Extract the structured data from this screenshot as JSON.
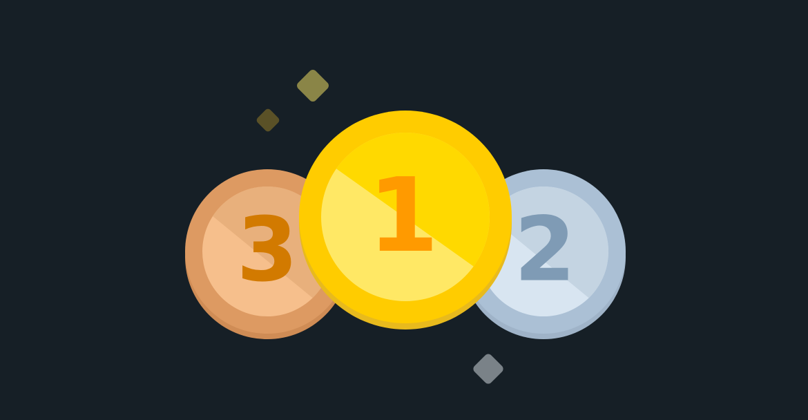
{
  "medals": {
    "bronze": {
      "number": "3",
      "colors": {
        "rim_shadow": "#cf8c55",
        "rim": "#dd9a62",
        "face_dark": "#e8b07c",
        "face_light": "#f6bf8c",
        "digit": "#d27a00"
      }
    },
    "silver": {
      "number": "2",
      "colors": {
        "rim_shadow": "#9fb3c8",
        "rim": "#abc0d5",
        "face_dark": "#c4d4e2",
        "face_light": "#d8e5f1",
        "digit": "#7f9bb5"
      }
    },
    "gold": {
      "number": "1",
      "colors": {
        "rim_shadow": "#e8ba1d",
        "rim": "#ffcc00",
        "face_dark": "#ffd900",
        "face_light": "#ffe865",
        "digit": "#ff9a00"
      }
    }
  },
  "sparkles": {
    "colors": {
      "olive_large": "#8a8547",
      "olive_small": "#5a5127",
      "gray": "#7a8288"
    }
  },
  "background_color": "#161f26"
}
